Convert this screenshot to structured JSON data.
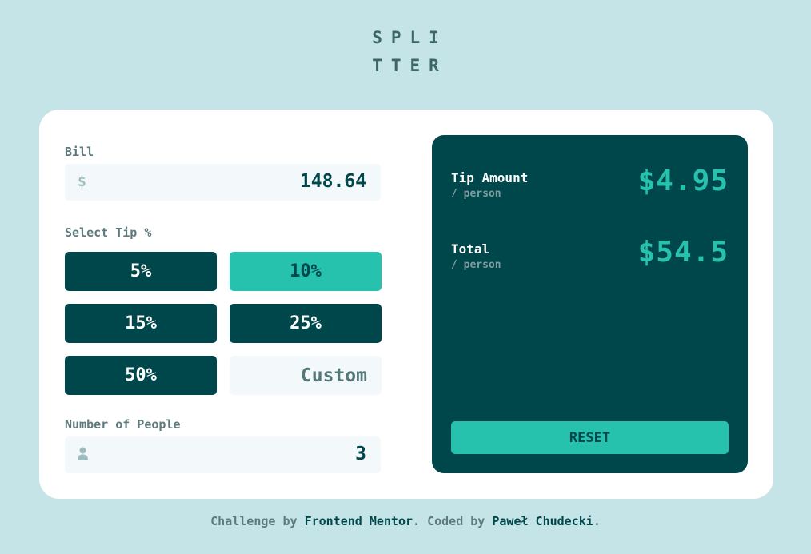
{
  "logo": {
    "line1": "SPLI",
    "line2": "TTER"
  },
  "bill": {
    "label": "Bill",
    "currency_symbol": "$",
    "value": "148.64"
  },
  "tip": {
    "label": "Select Tip %",
    "options": [
      "5%",
      "10%",
      "15%",
      "25%",
      "50%"
    ],
    "selected": "10%",
    "custom_placeholder": "Custom"
  },
  "people": {
    "label": "Number of People",
    "value": "3",
    "icon": "person-icon"
  },
  "results": {
    "tip_label": "Tip Amount",
    "tip_sub": "/ person",
    "tip_amount": "$4.95",
    "total_label": "Total",
    "total_sub": "/ person",
    "total_amount": "$54.5",
    "reset_label": "RESET"
  },
  "footer": {
    "prefix": "Challenge by ",
    "link1": "Frontend Mentor",
    "middle": ". Coded by ",
    "link2": "Paweł Chudecki",
    "suffix": "."
  },
  "colors": {
    "background": "#c5e4e7",
    "dark_cyan": "#00474b",
    "strong_cyan": "#26c2ad",
    "input_bg": "#f3f9fa"
  }
}
